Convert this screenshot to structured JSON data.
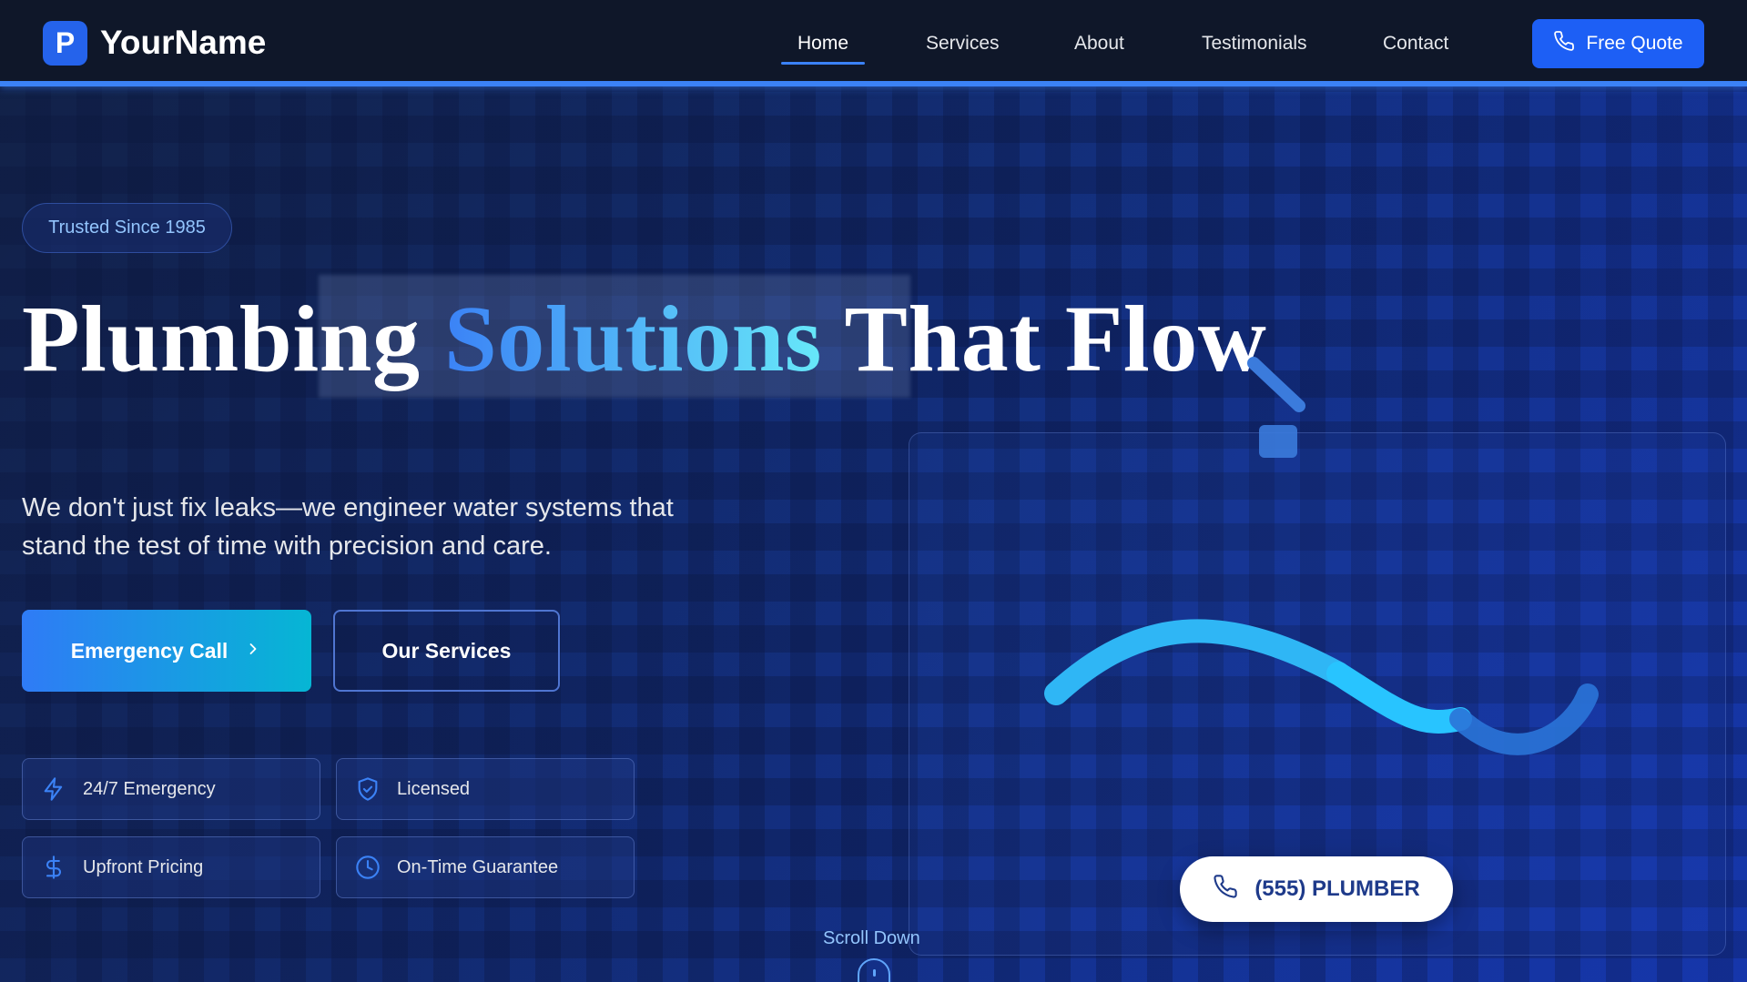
{
  "brand": {
    "mark": "P",
    "name": "YourName"
  },
  "nav": {
    "items": [
      {
        "label": "Home",
        "active": true
      },
      {
        "label": "Services"
      },
      {
        "label": "About"
      },
      {
        "label": "Testimonials"
      },
      {
        "label": "Contact"
      }
    ],
    "cta_label": "Free Quote"
  },
  "hero": {
    "badge": "Trusted Since 1985",
    "headline_part1": "Plumbing",
    "headline_accent": "Solutions",
    "headline_part2": "That Flow",
    "lead": "We don't just fix leaks—we engineer water systems that stand the test of time with precision and care.",
    "primary_button": "Emergency Call",
    "secondary_button": "Our Services",
    "features": [
      {
        "label": "24/7 Emergency",
        "icon": "bolt-icon"
      },
      {
        "label": "Licensed",
        "icon": "shield-check-icon"
      },
      {
        "label": "Upfront Pricing",
        "icon": "dollar-icon"
      },
      {
        "label": "On-Time Guarantee",
        "icon": "clock-icon"
      }
    ],
    "phone": "(555) PLUMBER",
    "scroll_label": "Scroll Down"
  },
  "colors": {
    "accent": "#3b82f6",
    "cta": "#1d5ff5",
    "nav_bg": "#0f1729",
    "accent_gradient_start": "#3b82f6",
    "accent_gradient_end": "#67e8f9",
    "emergency_start": "#2f7bf6",
    "emergency_end": "#06b6d4"
  }
}
